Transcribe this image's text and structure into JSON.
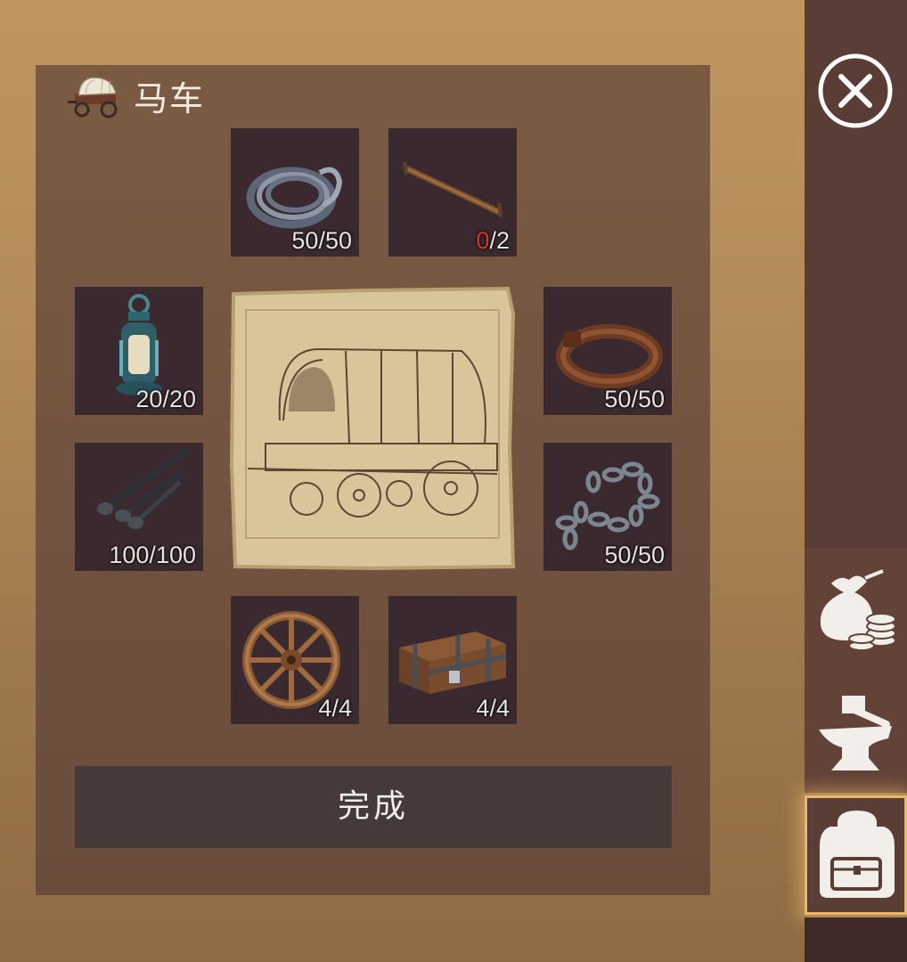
{
  "recipe": {
    "title": "马车",
    "title_icon": "covered-wagon-icon",
    "blueprint_icon": "wagon-blueprint-image"
  },
  "ingredients": [
    {
      "id": "rope",
      "icon": "rope-icon",
      "have": "50",
      "need": "50"
    },
    {
      "id": "rod",
      "icon": "iron-rod-icon",
      "have": "0",
      "need": "2",
      "short": true
    },
    {
      "id": "lantern",
      "icon": "lantern-icon",
      "have": "20",
      "need": "20"
    },
    {
      "id": "leather",
      "icon": "leather-belt-icon",
      "have": "50",
      "need": "50"
    },
    {
      "id": "nails",
      "icon": "nails-icon",
      "have": "100",
      "need": "100"
    },
    {
      "id": "chain",
      "icon": "chain-icon",
      "have": "50",
      "need": "50"
    },
    {
      "id": "wheel",
      "icon": "wooden-wheel-icon",
      "have": "4",
      "need": "4"
    },
    {
      "id": "chest",
      "icon": "chest-icon",
      "have": "4",
      "need": "4"
    }
  ],
  "actions": {
    "done_label": "完成"
  },
  "sidebar": {
    "close_icon": "close-icon",
    "tabs": [
      {
        "id": "trade",
        "icon": "money-bag-coins-icon",
        "active": false
      },
      {
        "id": "craft",
        "icon": "anvil-hammer-icon",
        "active": false
      },
      {
        "id": "backpack",
        "icon": "backpack-icon",
        "active": true
      }
    ]
  },
  "colors": {
    "panel": "#715240",
    "slot": "#3a2a30",
    "button": "#463a39",
    "shortage": "#d23a2a",
    "active_glow": "#e7b86a"
  }
}
